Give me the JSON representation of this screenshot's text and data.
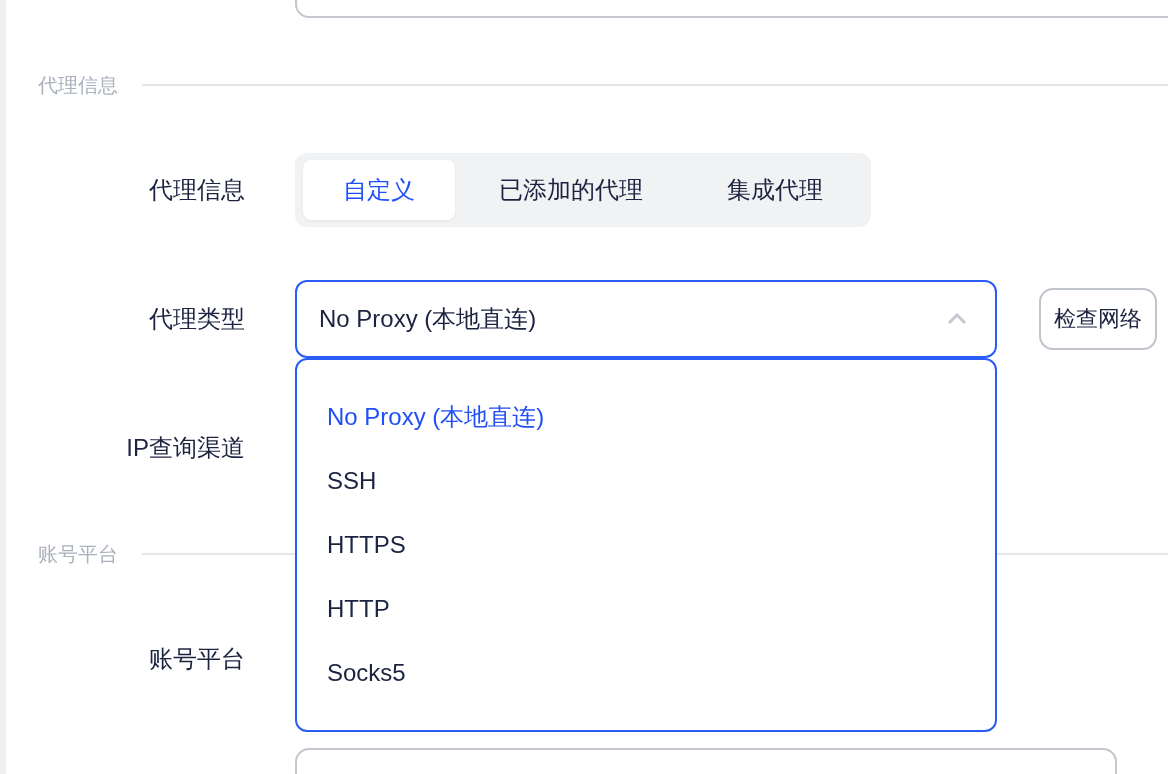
{
  "sections": [
    {
      "title": "代理信息",
      "rows": [
        {
          "label": "代理信息",
          "kind": "segmented",
          "options": [
            {
              "label": "自定义",
              "selected": true
            },
            {
              "label": "已添加的代理",
              "selected": false
            },
            {
              "label": "集成代理",
              "selected": false
            }
          ]
        },
        {
          "label": "代理类型",
          "kind": "select",
          "value": "No Proxy (本地直连)",
          "expanded": true,
          "button": "检查网络",
          "options": [
            {
              "label": "No Proxy (本地直连)",
              "selected": true
            },
            {
              "label": "SSH",
              "selected": false
            },
            {
              "label": "HTTPS",
              "selected": false
            },
            {
              "label": "HTTP",
              "selected": false
            },
            {
              "label": "Socks5",
              "selected": false
            }
          ]
        },
        {
          "label": "IP查询渠道",
          "kind": "covered"
        }
      ]
    },
    {
      "title": "账号平台",
      "rows": [
        {
          "label": "账号平台",
          "kind": "covered"
        }
      ]
    }
  ]
}
